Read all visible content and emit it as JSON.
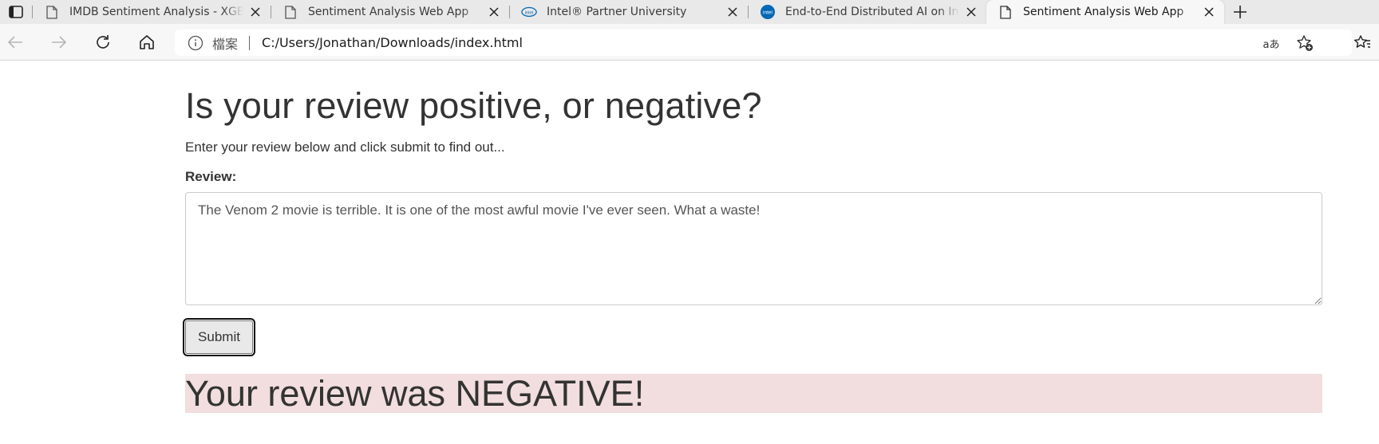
{
  "browser": {
    "tabs": [
      {
        "title": "IMDB Sentiment Analysis - XGBoost",
        "icon": "page-icon",
        "active": false
      },
      {
        "title": "Sentiment Analysis Web App",
        "icon": "page-icon",
        "active": false
      },
      {
        "title": "Intel® Partner University",
        "icon": "intel-logo-icon",
        "active": false
      },
      {
        "title": "End-to-End Distributed AI on Intel",
        "icon": "intel-logo-icon",
        "active": false
      },
      {
        "title": "Sentiment Analysis Web App",
        "icon": "page-icon",
        "active": true
      }
    ],
    "site_info_label": "檔案",
    "url": "C:/Users/Jonathan/Downloads/index.html",
    "toolbar_icons": [
      "back-icon",
      "forward-icon",
      "refresh-icon",
      "home-icon",
      "read-aloud-icon",
      "add-favorite-icon",
      "favorites-icon"
    ],
    "translate_label": "aあ"
  },
  "page": {
    "title": "Is your review positive, or negative?",
    "intro": "Enter your review below and click submit to find out...",
    "review_label": "Review:",
    "review_value": "The Venom 2 movie is terrible. It is one of the most awful movie I've ever seen. What a waste!",
    "submit_label": "Submit",
    "result_text": "Your review was NEGATIVE!",
    "result_color": "#f2dede"
  },
  "colors": {
    "tabstrip_bg": "#e9e9e9",
    "toolbar_bg": "#f7f7f7",
    "text": "#333333"
  }
}
